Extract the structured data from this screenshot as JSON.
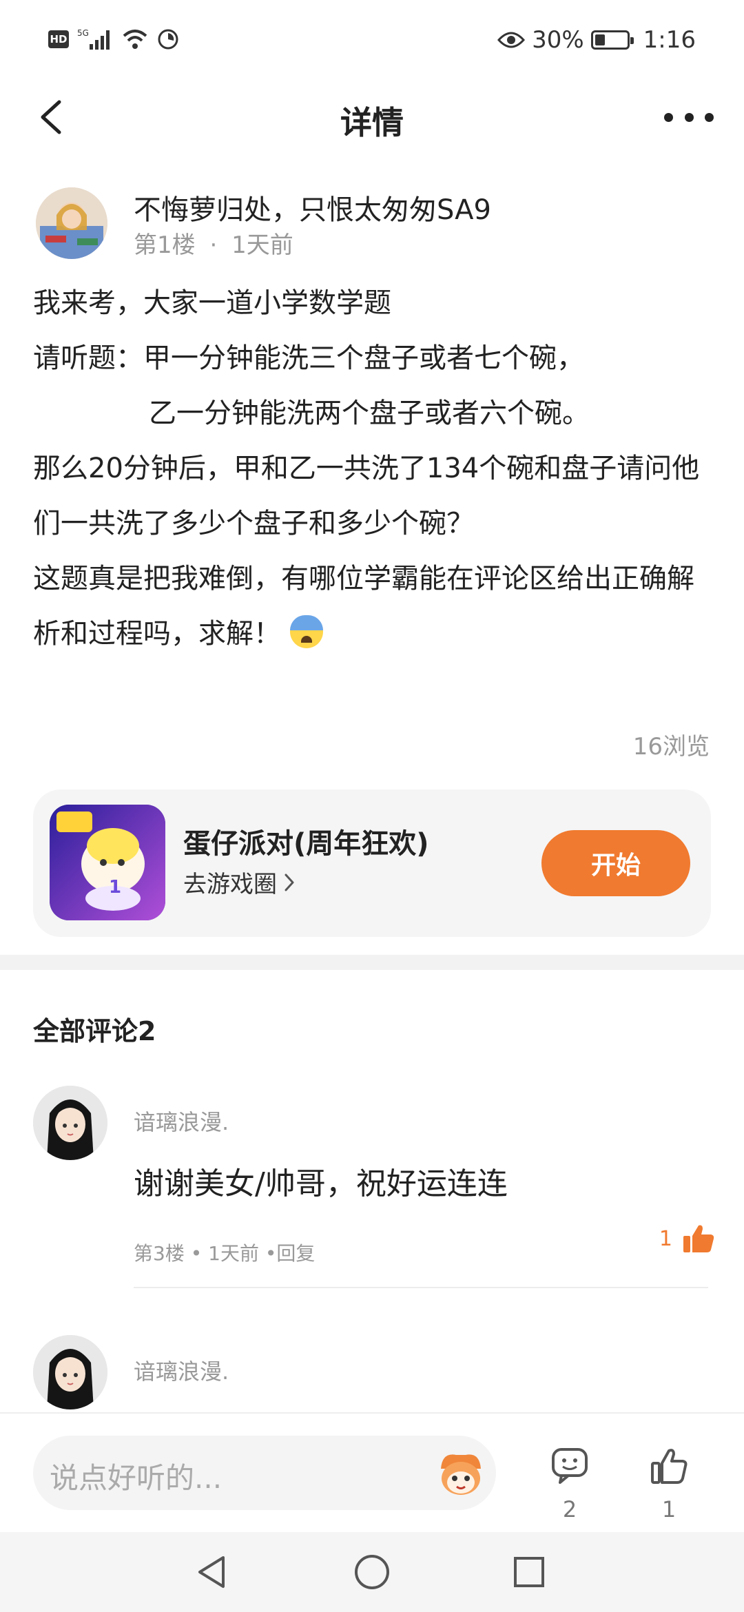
{
  "status_bar": {
    "network": "5G",
    "battery_percent": "30%",
    "time": "1:16"
  },
  "header": {
    "title": "详情"
  },
  "post": {
    "author_name": "不悔萝归处，只恨太匆匆SA9",
    "floor": "第1楼",
    "dot": "·",
    "time_ago": "1天前",
    "lines": {
      "l1": "我来考，大家一道小学数学题",
      "l2": "请听题：甲一分钟能洗三个盘子或者七个碗，",
      "l3": "乙一分钟能洗两个盘子或者六个碗。",
      "l4": "那么20分钟后，甲和乙一共洗了134个碗和盘子请问他们一共洗了多少个盘子和多少个碗？",
      "l5": "这题真是把我难倒，有哪位学霸能在评论区给出正确解析和过程吗，求解！"
    },
    "views": "16浏览"
  },
  "game_card": {
    "name": "蛋仔派对(周年狂欢)",
    "link_label": "去游戏圈",
    "button_label": "开始"
  },
  "comments": {
    "title": "全部评论2",
    "items": [
      {
        "user": "谙璃浪漫.",
        "text": "谢谢美女/帅哥，祝好运连连",
        "meta": "第3楼 • 1天前 •回复",
        "likes": "1"
      },
      {
        "user": "谙璃浪漫."
      }
    ]
  },
  "bottom_bar": {
    "input_placeholder": "说点好听的...",
    "comment_count": "2",
    "like_count": "1"
  },
  "colors": {
    "accent": "#f07a2f",
    "text_primary": "#222222",
    "text_secondary": "#999999"
  }
}
